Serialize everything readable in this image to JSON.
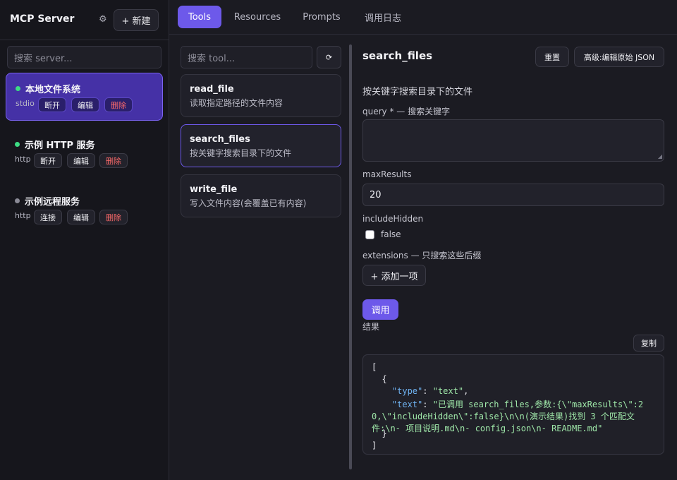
{
  "sidebar": {
    "title": "MCP Server",
    "new_label": "+ 新建",
    "search_placeholder": "搜索 server...",
    "servers": [
      {
        "name": "本地文件系统",
        "type": "stdio",
        "status_color": "#3ddc84",
        "btn1": "断开",
        "btn2": "编辑",
        "btn3": "删除"
      },
      {
        "name": "示例 HTTP 服务",
        "type": "http",
        "status_color": "#3ddc84",
        "btn1": "断开",
        "btn2": "编辑",
        "btn3": "删除"
      },
      {
        "name": "示例远程服务",
        "type": "http",
        "status_color": "#8a8a96",
        "btn1": "连接",
        "btn2": "编辑",
        "btn3": "删除"
      }
    ]
  },
  "tabs": [
    "Tools",
    "Resources",
    "Prompts",
    "调用日志"
  ],
  "tools": {
    "search_placeholder": "搜索 tool...",
    "refresh_label": "⟳",
    "items": [
      {
        "name": "read_file",
        "desc": "读取指定路径的文件内容"
      },
      {
        "name": "search_files",
        "desc": "按关键字搜索目录下的文件"
      },
      {
        "name": "write_file",
        "desc": "写入文件内容(会覆盖已有内容)"
      }
    ]
  },
  "detail": {
    "title": "search_files",
    "reset_label": "重置",
    "raw_label": "高级:编辑原始 JSON",
    "description": "按关键字搜索目录下的文件",
    "query_label": "query * — 搜索关键字",
    "max_label": "maxResults",
    "max_value": "20",
    "hidden_label": "includeHidden",
    "hidden_value": "false",
    "ext_label": "extensions — 只搜索这些后缀",
    "add_label": "+ 添加一项",
    "invoke_label": "调用",
    "result_label": "结果",
    "copy_label": "复制",
    "code": {
      "l1": "[",
      "l2": "  {",
      "l3_key": "\"type\"",
      "l3_val": "\"text\"",
      "l4_key": "\"text\"",
      "l4_val": "\"已调用 search_files,参数:{\\\"maxResults\\\":2",
      "l5_val": "0,\\\"includeHidden\\\":false}\\n\\n(演示结果)找到 3 个匹配文",
      "l6_val": "件:\\n- 项目说明.md\\n- config.json\\n- README.md\"",
      "l7": "  }",
      "l8": "]"
    }
  }
}
